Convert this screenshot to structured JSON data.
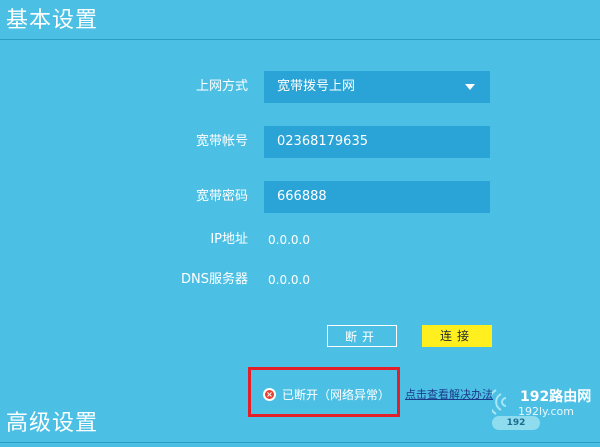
{
  "sections": {
    "basic_title": "基本设置",
    "advanced_title": "高级设置"
  },
  "form": {
    "connection_type": {
      "label": "上网方式",
      "value": "宽带拨号上网"
    },
    "account": {
      "label": "宽带帐号",
      "value": "02368179635"
    },
    "password": {
      "label": "宽带密码",
      "value": "666888"
    },
    "ip": {
      "label": "IP地址",
      "value": "0.0.0.0"
    },
    "dns": {
      "label": "DNS服务器",
      "value": "0.0.0.0"
    }
  },
  "buttons": {
    "disconnect": "断开",
    "connect": "连接"
  },
  "status": {
    "icon": "error-x-icon",
    "text": "已断开（网络异常）",
    "help_link": "点击查看解决办法"
  },
  "watermark": {
    "brand": "192路由网",
    "site": "192ly.com",
    "badge": "192"
  },
  "colors": {
    "background": "#4cc0e4",
    "field": "#2aa3d6",
    "connect_button": "#ffef1e",
    "highlight_box": "#e3202a"
  }
}
